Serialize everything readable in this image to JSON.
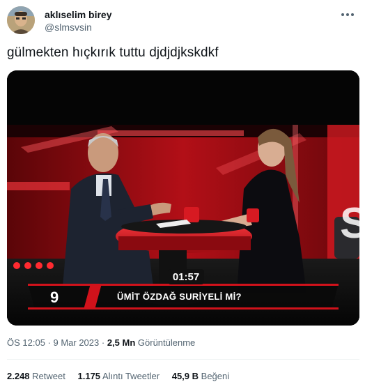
{
  "user": {
    "display_name": "aklıselim birey",
    "handle": "@slmsvsin",
    "avatar_icon": "user-avatar",
    "more_icon": "more-options-icon"
  },
  "tweet": {
    "text": "gülmekten hıçkırık tuttu djdjdjkskdkf"
  },
  "video": {
    "duration": "01:57",
    "chyron_number": "9",
    "chyron_text": "ÜMİT ÖZDAĞ SURİYELİ Mİ?",
    "accent": "#d1121b"
  },
  "meta": {
    "time_date": "ÖS 12:05 · 9 Mar 2023 ·",
    "views_count": "2,5 Mn",
    "views_label": "Görüntülenme"
  },
  "stats": {
    "retweets_count": "2.248",
    "retweets_label": "Retweet",
    "quotes_count": "1.175",
    "quotes_label": "Alıntı Tweetler",
    "likes_count": "45,9 B",
    "likes_label": "Beğeni"
  },
  "colors": {
    "text_primary": "#0f1419",
    "text_secondary": "#536471",
    "divider": "#eff3f4"
  }
}
